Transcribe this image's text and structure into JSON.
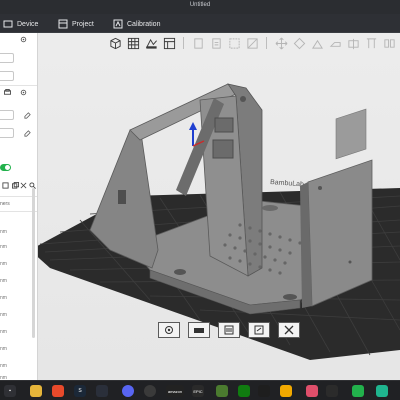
{
  "window": {
    "title": "Untitled"
  },
  "menu": {
    "items": [
      {
        "label": "Device",
        "icon": "device-icon"
      },
      {
        "label": "Project",
        "icon": "project-icon"
      },
      {
        "label": "Calibration",
        "icon": "calibration-icon"
      }
    ]
  },
  "sidebar": {
    "rows": [
      "nm",
      "nm",
      "nm",
      "nm",
      "nm",
      "nm",
      "nm",
      "nm",
      "nm",
      "nm"
    ],
    "partial_label": "ners",
    "toggle_on": true
  },
  "toolbar": {
    "icons": [
      "add-cube-icon",
      "grid-icon",
      "arrange-icon",
      "layout-icon",
      "copy-icon",
      "paste-icon",
      "select-icon",
      "cut-icon",
      "move-icon",
      "rotate-icon",
      "scale-icon",
      "lay-flat-icon",
      "split-icon",
      "support-icon",
      "mirror-icon",
      "seam-icon"
    ]
  },
  "bottom_toolbar": {
    "icons": [
      "orient-icon",
      "view-icon",
      "slice-icon",
      "export-icon",
      "close-icon"
    ]
  },
  "colors": {
    "accent": "#22b14c",
    "plate": "#2b2b2b",
    "model": "#8c8c8c",
    "menubar": "#2e3035"
  },
  "taskbar": {
    "icons": [
      "windows-icon",
      "files-icon",
      "brave-icon",
      "steam-icon",
      "discord-icon",
      "obs-icon",
      "amazon-icon",
      "epic-icon",
      "minecraft-icon",
      "xbox-icon",
      "apple-icon",
      "ubisoft-icon",
      "music-icon",
      "bambu-icon",
      "chat-icon"
    ],
    "amazon_text": "amazon",
    "epic_text": "EPIC"
  }
}
